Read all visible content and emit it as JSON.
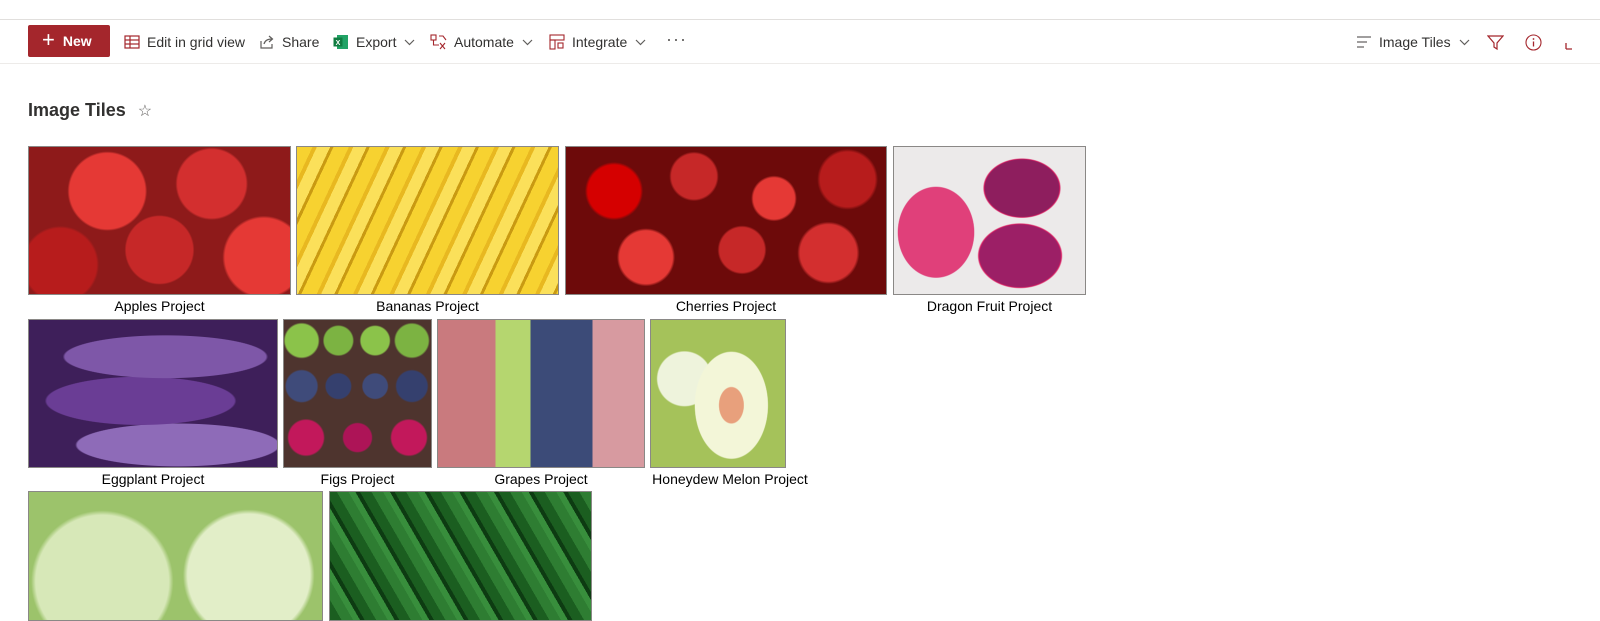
{
  "commandbar": {
    "new_label": "New",
    "edit_grid_label": "Edit in grid view",
    "share_label": "Share",
    "export_label": "Export",
    "automate_label": "Automate",
    "integrate_label": "Integrate",
    "more_label": "···",
    "view_label": "Image Tiles"
  },
  "page": {
    "title": "Image Tiles",
    "favorite_icon": "☆"
  },
  "tiles": [
    {
      "label": "Apples Project",
      "icon": "apples-image"
    },
    {
      "label": "Bananas Project",
      "icon": "bananas-image"
    },
    {
      "label": "Cherries Project",
      "icon": "cherries-image"
    },
    {
      "label": "Dragon Fruit Project",
      "icon": "dragon-fruit-image"
    },
    {
      "label": "Eggplant Project",
      "icon": "eggplant-image"
    },
    {
      "label": "Figs Project",
      "icon": "figs-image"
    },
    {
      "label": "Grapes Project",
      "icon": "grapes-image"
    },
    {
      "label": "Honeydew Melon Project",
      "icon": "honeydew-image"
    },
    {
      "label": "",
      "icon": "lettuce-image"
    },
    {
      "label": "",
      "icon": "peppers-image"
    }
  ],
  "colors": {
    "accent": "#a4262c",
    "excel_green": "#107c41",
    "tile_border": "#8a8886"
  }
}
